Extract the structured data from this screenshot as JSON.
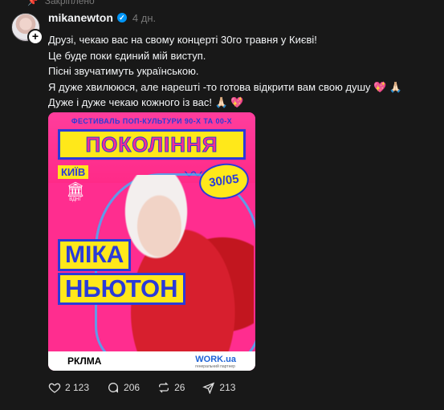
{
  "pinned_label": "Закріплено",
  "post": {
    "username": "mikanewton",
    "time": "4 дн.",
    "text_lines": [
      "Друзі, чекаю вас на свому концерті 30го травня у Києві!",
      "Це буде поки єдиний мій виступ.",
      "Пісні звучатимуть українською.",
      "Я дуже хвилююся, але нарешті -то готова відкрити вам свою душу 💖 🙏🏻",
      "Дуже і дуже чекаю кожного із вас! 🙏🏻 💖"
    ],
    "poster": {
      "festival": "ФЕСТИВАЛЬ ПОП-КУЛЬТУРИ 90-Х ТА 00-Х",
      "brand": "ПОКОЛІННЯ",
      "city": "КИЇВ",
      "venue": "ВДНГ",
      "date": "30/05",
      "artist_line1": "МІКА",
      "artist_line2": "НЬЮТОН",
      "footer_left": "РКЛМА",
      "footer_right": "WORK.ua",
      "footer_right_sub": "генеральний партнер"
    },
    "actions": {
      "likes": "2 123",
      "comments": "206",
      "reposts": "26",
      "shares": "213"
    }
  },
  "colors": {
    "background": "#181818",
    "poster_pink": "#ff2d8f",
    "poster_yellow": "#ffe81a",
    "poster_blue": "#2a3bd8",
    "verified_blue": "#0095f6"
  }
}
